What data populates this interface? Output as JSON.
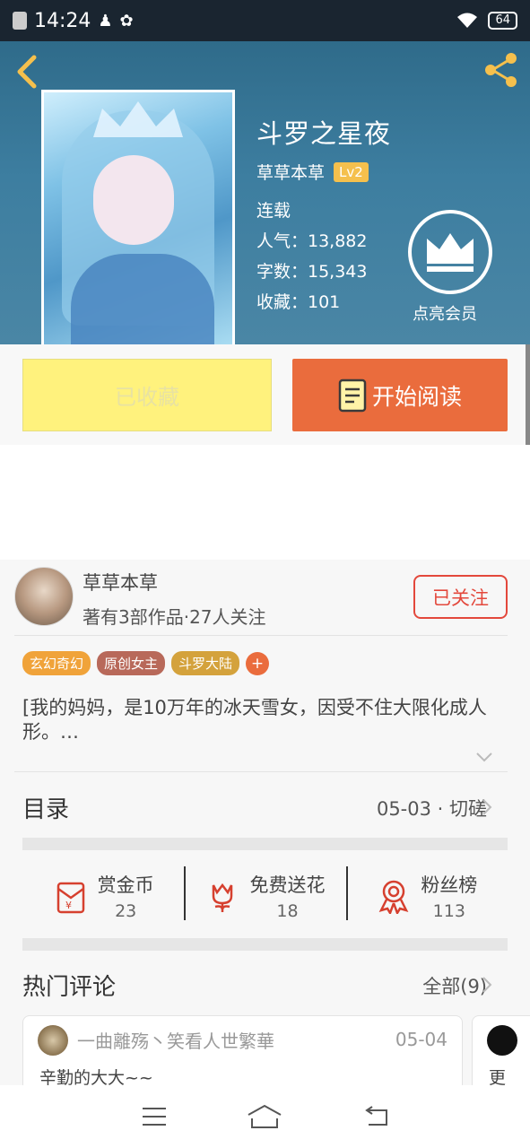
{
  "status_bar": {
    "time": "14:24",
    "battery": "64"
  },
  "book": {
    "title": "斗罗之星夜",
    "author": "草草本草",
    "level": "Lv2",
    "status": "连载",
    "popularity": "人气：13,882",
    "word_count": "字数：15,343",
    "favorites": "收藏：101"
  },
  "vip": {
    "label": "点亮会员"
  },
  "buttons": {
    "favorited": "已收藏",
    "start_reading": "开始阅读"
  },
  "author_card": {
    "name": "草草本草",
    "stats": "著有3部作品·27人关注",
    "follow_label": "已关注"
  },
  "tags": [
    {
      "label": "玄幻奇幻",
      "color": "#f0a33a"
    },
    {
      "label": "原创女主",
      "color": "#b8695a"
    },
    {
      "label": "斗罗大陆",
      "color": "#d4a23c"
    }
  ],
  "tag_add": "+",
  "intro": "[我的妈妈，是10万年的冰天雪女，因受不住大限化成人形。…",
  "toc": {
    "label": "目录",
    "latest": "05-03 · 切磋"
  },
  "stats": [
    {
      "title": "赏金币",
      "value": "23"
    },
    {
      "title": "免费送花",
      "value": "18"
    },
    {
      "title": "粉丝榜",
      "value": "113"
    }
  ],
  "hot_comments": {
    "label": "热门评论",
    "all": "全部(9)",
    "items": [
      {
        "user": "一曲離殇丶笑看人世繁華",
        "date": "05-04",
        "text": "辛勤的大大~~"
      },
      {
        "text": "更"
      }
    ]
  },
  "colors": {
    "accent": "#ea6c3d",
    "follow": "#e3483c",
    "favorite_bg": "#fff27d"
  }
}
